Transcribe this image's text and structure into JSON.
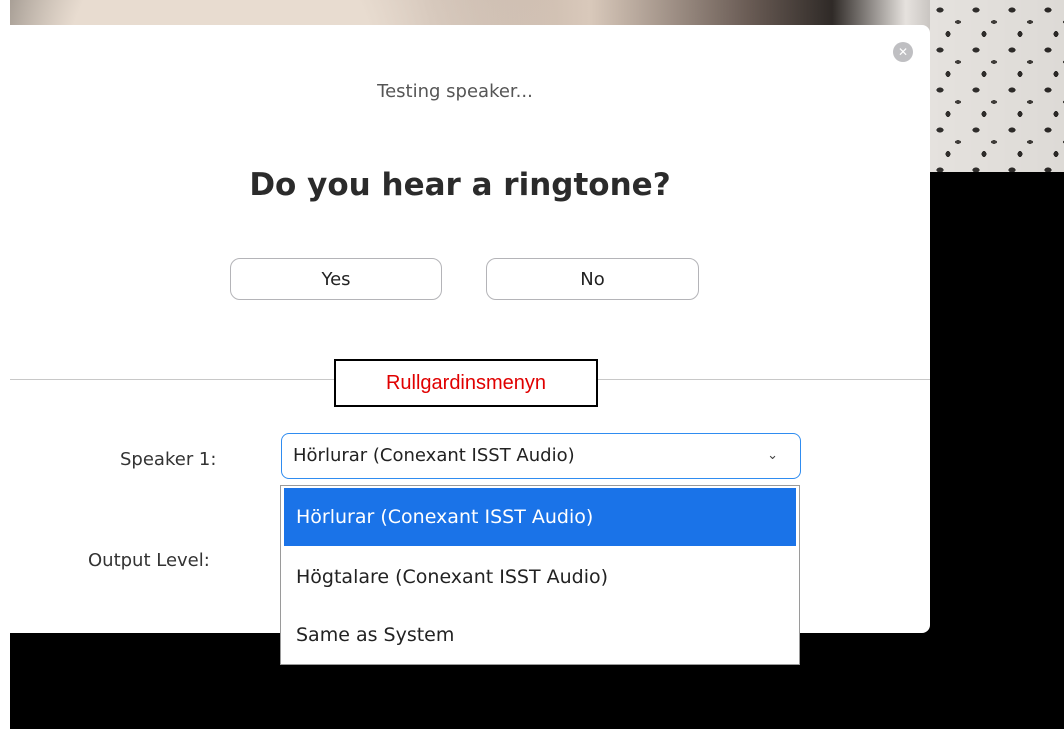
{
  "dialog": {
    "status_text": "Testing speaker...",
    "question": "Do you hear a ringtone?",
    "yes_label": "Yes",
    "no_label": "No",
    "close_icon": "close-icon"
  },
  "annotation": {
    "text": "Rullgardinsmenyn",
    "color": "#e00000"
  },
  "speaker": {
    "label": "Speaker 1:",
    "selected": "Hörlurar (Conexant ISST Audio)",
    "options": [
      "Hörlurar (Conexant ISST Audio)",
      "Högtalare (Conexant ISST Audio)",
      "Same as System"
    ]
  },
  "output": {
    "label": "Output Level:"
  },
  "colors": {
    "accent": "#1a73e8",
    "select_border": "#2f8cf0"
  }
}
